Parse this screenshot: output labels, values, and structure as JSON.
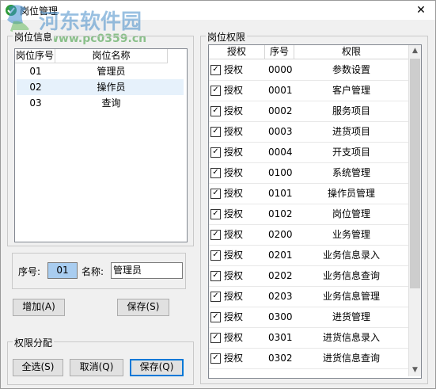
{
  "window": {
    "title": "岗位管理",
    "close_symbol": "✕"
  },
  "watermark": {
    "text": "河东软件园",
    "url": "www.pc0359.cn"
  },
  "position_group": {
    "label": "岗位信息",
    "columns": [
      "岗位序号",
      "岗位名称"
    ],
    "rows": [
      {
        "id": "01",
        "name": "管理员"
      },
      {
        "id": "02",
        "name": "操作员"
      },
      {
        "id": "03",
        "name": "查询"
      }
    ],
    "selected_row": 1
  },
  "editor": {
    "seq_label": "序号:",
    "seq_value": "01",
    "name_label": "名称:",
    "name_value": "管理员",
    "add_button": "增加(A)",
    "save_button": "保存(S)"
  },
  "perm_assign": {
    "label": "权限分配",
    "select_all": "全选(S)",
    "cancel": "取消(Q)",
    "save": "保存(Q)"
  },
  "perm_group": {
    "label": "岗位权限",
    "columns": [
      "授权",
      "序号",
      "权限"
    ],
    "rows": [
      {
        "checked": true,
        "grant": "授权",
        "code": "0000",
        "name": "参数设置"
      },
      {
        "checked": true,
        "grant": "授权",
        "code": "0001",
        "name": "客户管理"
      },
      {
        "checked": true,
        "grant": "授权",
        "code": "0002",
        "name": "服务项目"
      },
      {
        "checked": true,
        "grant": "授权",
        "code": "0003",
        "name": "进货项目"
      },
      {
        "checked": true,
        "grant": "授权",
        "code": "0004",
        "name": "开支项目"
      },
      {
        "checked": true,
        "grant": "授权",
        "code": "0100",
        "name": "系统管理"
      },
      {
        "checked": true,
        "grant": "授权",
        "code": "0101",
        "name": "操作员管理"
      },
      {
        "checked": true,
        "grant": "授权",
        "code": "0102",
        "name": "岗位管理"
      },
      {
        "checked": true,
        "grant": "授权",
        "code": "0200",
        "name": "业务管理"
      },
      {
        "checked": true,
        "grant": "授权",
        "code": "0201",
        "name": "业务信息录入"
      },
      {
        "checked": true,
        "grant": "授权",
        "code": "0202",
        "name": "业务信息查询"
      },
      {
        "checked": true,
        "grant": "授权",
        "code": "0203",
        "name": "业务信息管理"
      },
      {
        "checked": true,
        "grant": "授权",
        "code": "0300",
        "name": "进货管理"
      },
      {
        "checked": true,
        "grant": "授权",
        "code": "0301",
        "name": "进货信息录入"
      },
      {
        "checked": true,
        "grant": "授权",
        "code": "0302",
        "name": "进货信息查询"
      }
    ]
  },
  "colors": {
    "selected_row": "#e6f1fb",
    "accent": "#0078d7"
  }
}
